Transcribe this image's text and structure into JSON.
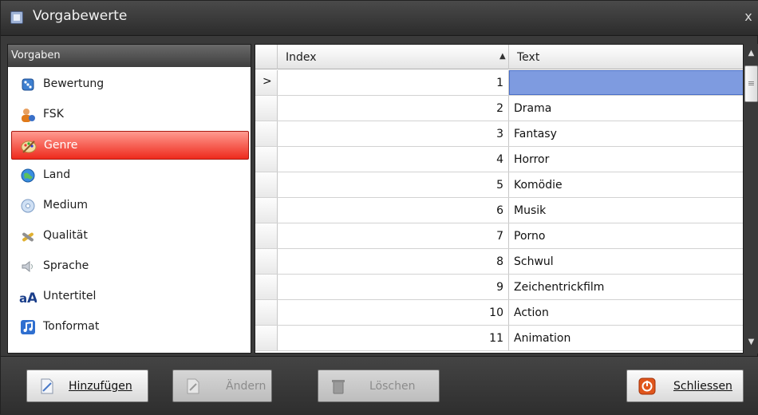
{
  "window": {
    "title": "Vorgabewerte",
    "close_glyph": "x"
  },
  "sidebar": {
    "header": "Vorgaben",
    "selected": "Genre",
    "items": [
      {
        "label": "Bewertung",
        "icon": "dice-icon"
      },
      {
        "label": "FSK",
        "icon": "users-icon"
      },
      {
        "label": "Genre",
        "icon": "palette-icon"
      },
      {
        "label": "Land",
        "icon": "globe-icon"
      },
      {
        "label": "Medium",
        "icon": "disc-icon"
      },
      {
        "label": "Qualität",
        "icon": "tools-icon"
      },
      {
        "label": "Sprache",
        "icon": "speaker-icon"
      },
      {
        "label": "Untertitel",
        "icon": "text-icon"
      },
      {
        "label": "Tonformat",
        "icon": "music-note-icon"
      }
    ]
  },
  "grid": {
    "columns": [
      "Index",
      "Text"
    ],
    "sort_indicator": "▲",
    "current_row_marker": ">",
    "rows": [
      {
        "index": "1",
        "text": ""
      },
      {
        "index": "2",
        "text": "Drama"
      },
      {
        "index": "3",
        "text": "Fantasy"
      },
      {
        "index": "4",
        "text": "Horror"
      },
      {
        "index": "5",
        "text": "Komödie"
      },
      {
        "index": "6",
        "text": "Musik"
      },
      {
        "index": "7",
        "text": "Porno"
      },
      {
        "index": "8",
        "text": "Schwul"
      },
      {
        "index": "9",
        "text": "Zeichentrickfilm"
      },
      {
        "index": "10",
        "text": "Action"
      },
      {
        "index": "11",
        "text": "Animation"
      }
    ]
  },
  "scrollbar": {
    "up": "▲",
    "down": "▼",
    "grip": "≡"
  },
  "footer": {
    "add_label": "Hinzufügen",
    "edit_label": "Ändern",
    "delete_label": "Löschen",
    "close_label": "Schliessen"
  },
  "colors": {
    "selection_red": "#ee2a1c",
    "cell_selected_blue": "#7e9be0"
  }
}
